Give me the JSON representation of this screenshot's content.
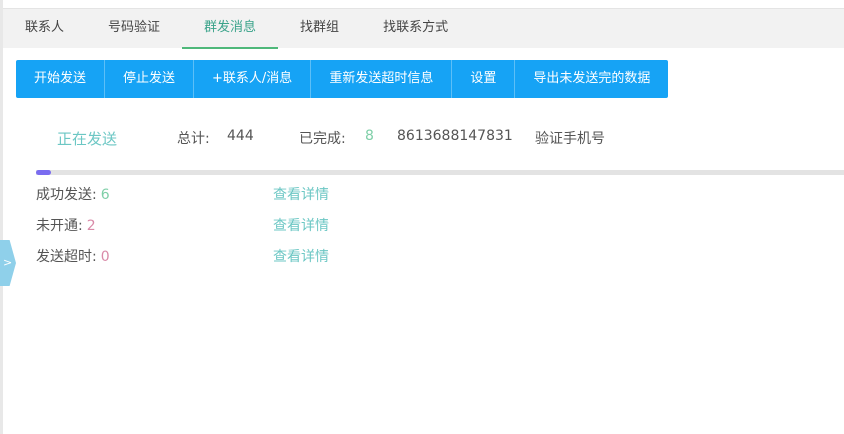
{
  "tabs": [
    "联系人",
    "号码验证",
    "群发消息",
    "找群组",
    "找联系方式"
  ],
  "active_tab": 2,
  "toolbar": [
    "开始发送",
    "停止发送",
    "+联系人/消息",
    "重新发送超时信息",
    "设置",
    "导出未发送完的数据"
  ],
  "status": {
    "state": "正在发送",
    "total_label": "总计:",
    "total": "444",
    "done_label": "已完成:",
    "done": "8",
    "phone": "8613688147831",
    "action": "验证手机号"
  },
  "progress_percent": 1.8,
  "results": [
    {
      "label": "成功发送:",
      "value": "6",
      "color": "#7fcfa8",
      "link": "查看详情"
    },
    {
      "label": "未开通:",
      "value": "2",
      "color": "#d98aa8",
      "link": "查看详情"
    },
    {
      "label": "发送超时:",
      "value": "0",
      "color": "#d98aa8",
      "link": "查看详情"
    }
  ],
  "side_handle": ">"
}
